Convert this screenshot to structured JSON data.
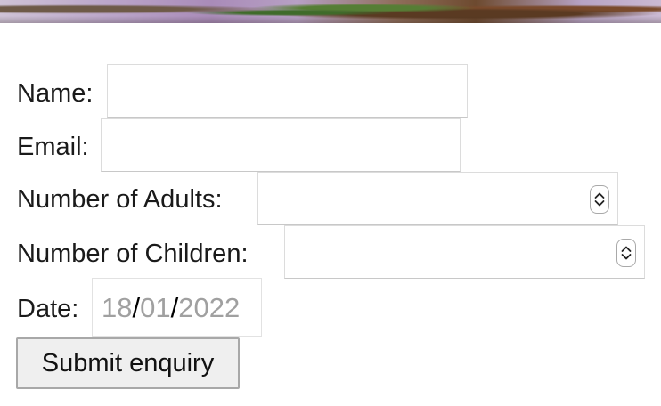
{
  "form": {
    "name_label": "Name:",
    "email_label": "Email:",
    "adults_label": "Number of Adults:",
    "children_label": "Number of Children:",
    "date_label": "Date:",
    "date": {
      "day": "18",
      "month": "01",
      "year": "2022",
      "separator": "/"
    },
    "submit_label": "Submit enquiry"
  }
}
